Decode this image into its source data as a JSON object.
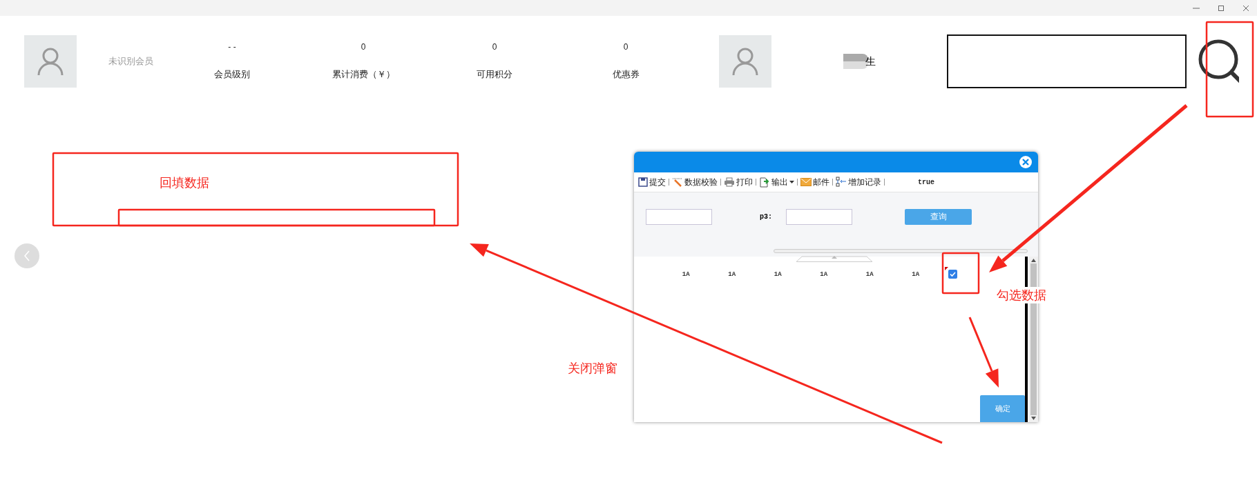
{
  "member": {
    "status": "未识别会员"
  },
  "stats": [
    {
      "value": "- -",
      "label": "会员级别"
    },
    {
      "value": "0",
      "label": "累计消费（￥）"
    },
    {
      "value": "0",
      "label": "可用积分"
    },
    {
      "value": "0",
      "label": "优惠券"
    }
  ],
  "staff": {
    "name": "生"
  },
  "dialog": {
    "toolbar": [
      {
        "label": "提交",
        "kind": "save",
        "dropdown": false
      },
      {
        "label": "数据校验",
        "kind": "check",
        "dropdown": false
      },
      {
        "label": "打印",
        "kind": "print",
        "dropdown": false
      },
      {
        "label": "输出",
        "kind": "export",
        "dropdown": true
      },
      {
        "label": "邮件",
        "kind": "mail",
        "dropdown": false
      },
      {
        "label": "增加记录",
        "kind": "add",
        "dropdown": false
      }
    ],
    "toolbar_text": "true",
    "filter": {
      "label": "p3:",
      "button": "查询"
    },
    "rows": [
      {
        "cells": [
          "1A",
          "1A",
          "1A",
          "1A",
          "1A",
          "1A"
        ],
        "checked": true
      }
    ],
    "confirm": "确定"
  },
  "annotations": [
    {
      "text": "回填数据"
    },
    {
      "text": "勾选数据"
    },
    {
      "text": "关闭弹窗"
    }
  ]
}
